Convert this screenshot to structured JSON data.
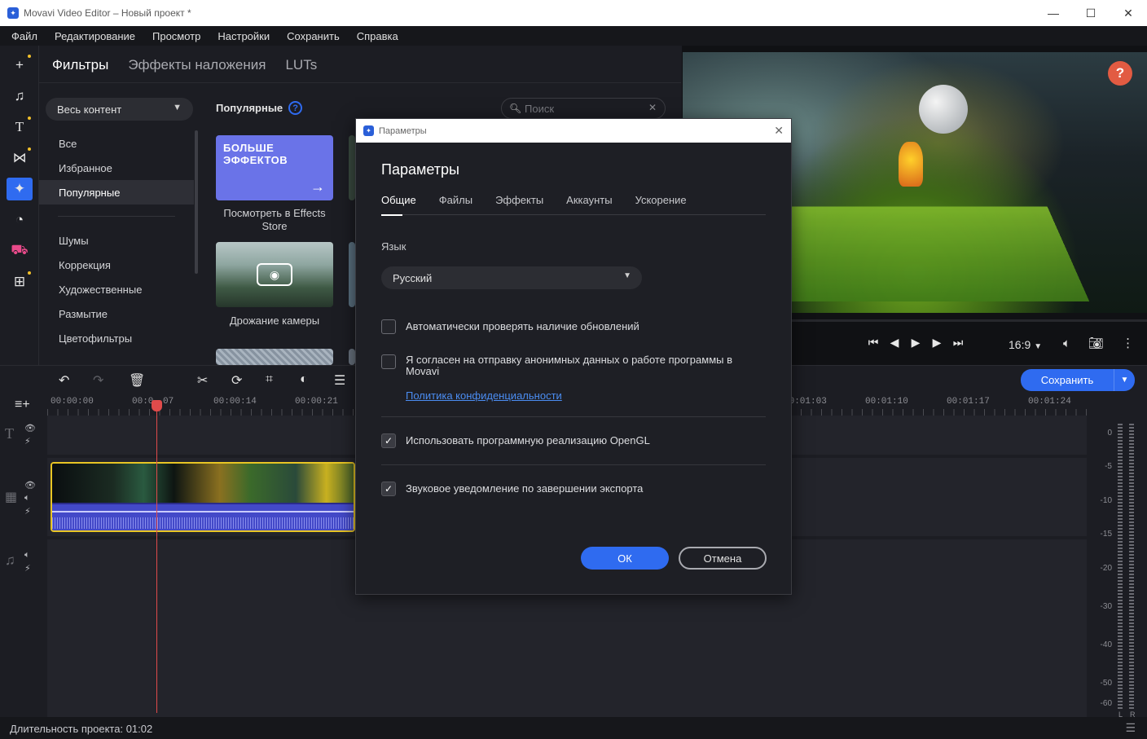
{
  "window": {
    "title": "Movavi Video Editor – Новый проект *",
    "min": "—",
    "max": "☐",
    "close": "✕"
  },
  "menu": [
    "Файл",
    "Редактирование",
    "Просмотр",
    "Настройки",
    "Сохранить",
    "Справка"
  ],
  "rail": {
    "tools": [
      "plus-icon",
      "music-icon",
      "text-icon",
      "transition-icon",
      "filters-icon",
      "clock-icon",
      "stickers-icon",
      "more-tools-icon"
    ]
  },
  "filters": {
    "tabs": [
      "Фильтры",
      "Эффекты наложения",
      "LUTs"
    ],
    "content_select": "Весь контент",
    "categories_top": [
      "Все",
      "Избранное",
      "Популярные"
    ],
    "categories_bottom": [
      "Шумы",
      "Коррекция",
      "Художественные",
      "Размытие",
      "Цветофильтры"
    ],
    "section_title": "Популярные",
    "search_placeholder": "Поиск",
    "card_more_text": "БОЛЬШЕ ЭФФЕКТОВ",
    "card_more_label": "Посмотреть в Effects Store",
    "card_shake_label": "Дрожание камеры"
  },
  "preview": {
    "help": "?",
    "ratio": "16:9"
  },
  "save": {
    "label": "Сохранить"
  },
  "timeline": {
    "ruler": [
      "00:00:00",
      "00:0",
      "07",
      "00:00:14",
      "00:00:21",
      "00:01:03",
      "00:01:10",
      "00:01:17",
      "00:01:24"
    ]
  },
  "meter": {
    "levels": [
      "0",
      "-5",
      "-10",
      "-15",
      "-20",
      "-30",
      "-40",
      "-50",
      "-60"
    ],
    "left": "L",
    "right": "R"
  },
  "status": {
    "duration": "Длительность проекта: 01:02"
  },
  "dialog": {
    "title": "Параметры",
    "heading": "Параметры",
    "tabs": [
      "Общие",
      "Файлы",
      "Эффекты",
      "Аккаунты",
      "Ускорение"
    ],
    "lang_label": "Язык",
    "lang_value": "Русский",
    "opt_updates": "Автоматически проверять наличие обновлений",
    "opt_anon": "Я согласен на отправку анонимных данных о работе программы в Movavi",
    "privacy_link": "Политика конфиденциальности",
    "opt_opengl": "Использовать программную реализацию OpenGL",
    "opt_sound": "Звуковое уведомление по завершении экспорта",
    "ok": "ОК",
    "cancel": "Отмена"
  }
}
